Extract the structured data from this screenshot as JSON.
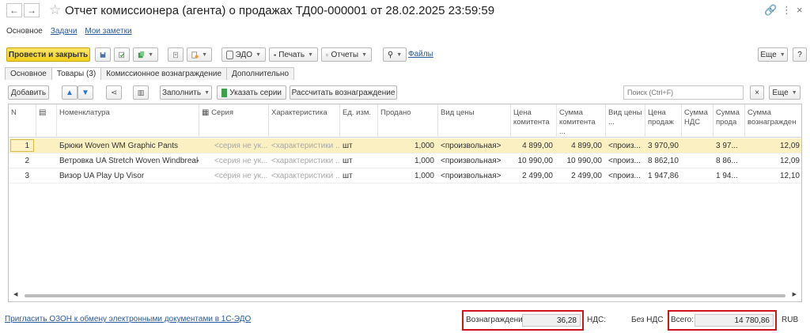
{
  "window": {
    "title": "Отчет комиссионера (агента) о продажах ТД00-000001 от 28.02.2025 23:59:59"
  },
  "section_tabs": [
    "Основное",
    "Задачи",
    "Мои заметки"
  ],
  "toolbar": {
    "post_close": "Провести и закрыть",
    "edo": "ЭДО",
    "print": "Печать",
    "reports": "Отчеты",
    "files": "Файлы",
    "more": "Еще",
    "help": "?"
  },
  "page_tabs": [
    "Основное",
    "Товары (3)",
    "Комиссионное вознаграждение",
    "Дополнительно"
  ],
  "inner_toolbar": {
    "add": "Добавить",
    "fill": "Заполнить",
    "specify_series": "Указать серии",
    "calc_fee": "Рассчитать вознаграждение",
    "search_placeholder": "Поиск (Ctrl+F)",
    "clear": "×",
    "more": "Еще"
  },
  "table": {
    "headers": {
      "n": "N",
      "nomenclature": "Номенклатура",
      "series": "Серия",
      "characteristic": "Характеристика",
      "unit": "Ед. изм.",
      "sold": "Продано",
      "price_type": "Вид цены",
      "price_committent": "Цена комитента",
      "sum_committent": "Сумма комитента ...",
      "price_type2": "Вид цены ...",
      "price_sales": "Цена продаж",
      "sum_vat": "Сумма НДС",
      "sum_sales": "Сумма прода",
      "sum_fee": "Сумма вознагражден"
    },
    "rows": [
      {
        "n": "1",
        "name": "Брюки Woven WM Graphic Pants",
        "series": "<серия не ук...",
        "char": "<характеристики ...",
        "unit": "шт",
        "sold": "1,000",
        "price_type": "<произвольная>",
        "price_committent": "4 899,00",
        "sum_committent": "4 899,00",
        "price_type2": "<произ...",
        "price_sales": "3 970,90",
        "sum_vat": "",
        "sum_sales": "3 97...",
        "sum_fee": "12,09"
      },
      {
        "n": "2",
        "name": "Ветровка UA Stretch Woven Windbreaker",
        "series": "<серия не ук...",
        "char": "<характеристики ...",
        "unit": "шт",
        "sold": "1,000",
        "price_type": "<произвольная>",
        "price_committent": "10 990,00",
        "sum_committent": "10 990,00",
        "price_type2": "<произ...",
        "price_sales": "8 862,10",
        "sum_vat": "",
        "sum_sales": "8 86...",
        "sum_fee": "12,09"
      },
      {
        "n": "3",
        "name": "Визор UA Play Up Visor",
        "series": "<серия не ук...",
        "char": "<характеристики ...",
        "unit": "шт",
        "sold": "1,000",
        "price_type": "<произвольная>",
        "price_committent": "2 499,00",
        "sum_committent": "2 499,00",
        "price_type2": "<произ...",
        "price_sales": "1 947,86",
        "sum_vat": "",
        "sum_sales": "1 94...",
        "sum_fee": "12,10"
      }
    ]
  },
  "footer": {
    "invite_link": "Пригласить ОЗОН к обмену электронными документами в 1С-ЭДО",
    "fee_label": "Вознаграждение:",
    "fee_value": "36,28",
    "vat_label": "НДС:",
    "vat_value": "Без НДС",
    "total_label": "Всего:",
    "total_value": "14 780,86",
    "currency": "RUB"
  },
  "colors": {
    "primary_button": "#f2cf1b",
    "selected_row": "#fbf0c2",
    "link": "#2a5a9a",
    "highlight_box": "#d0141c"
  }
}
